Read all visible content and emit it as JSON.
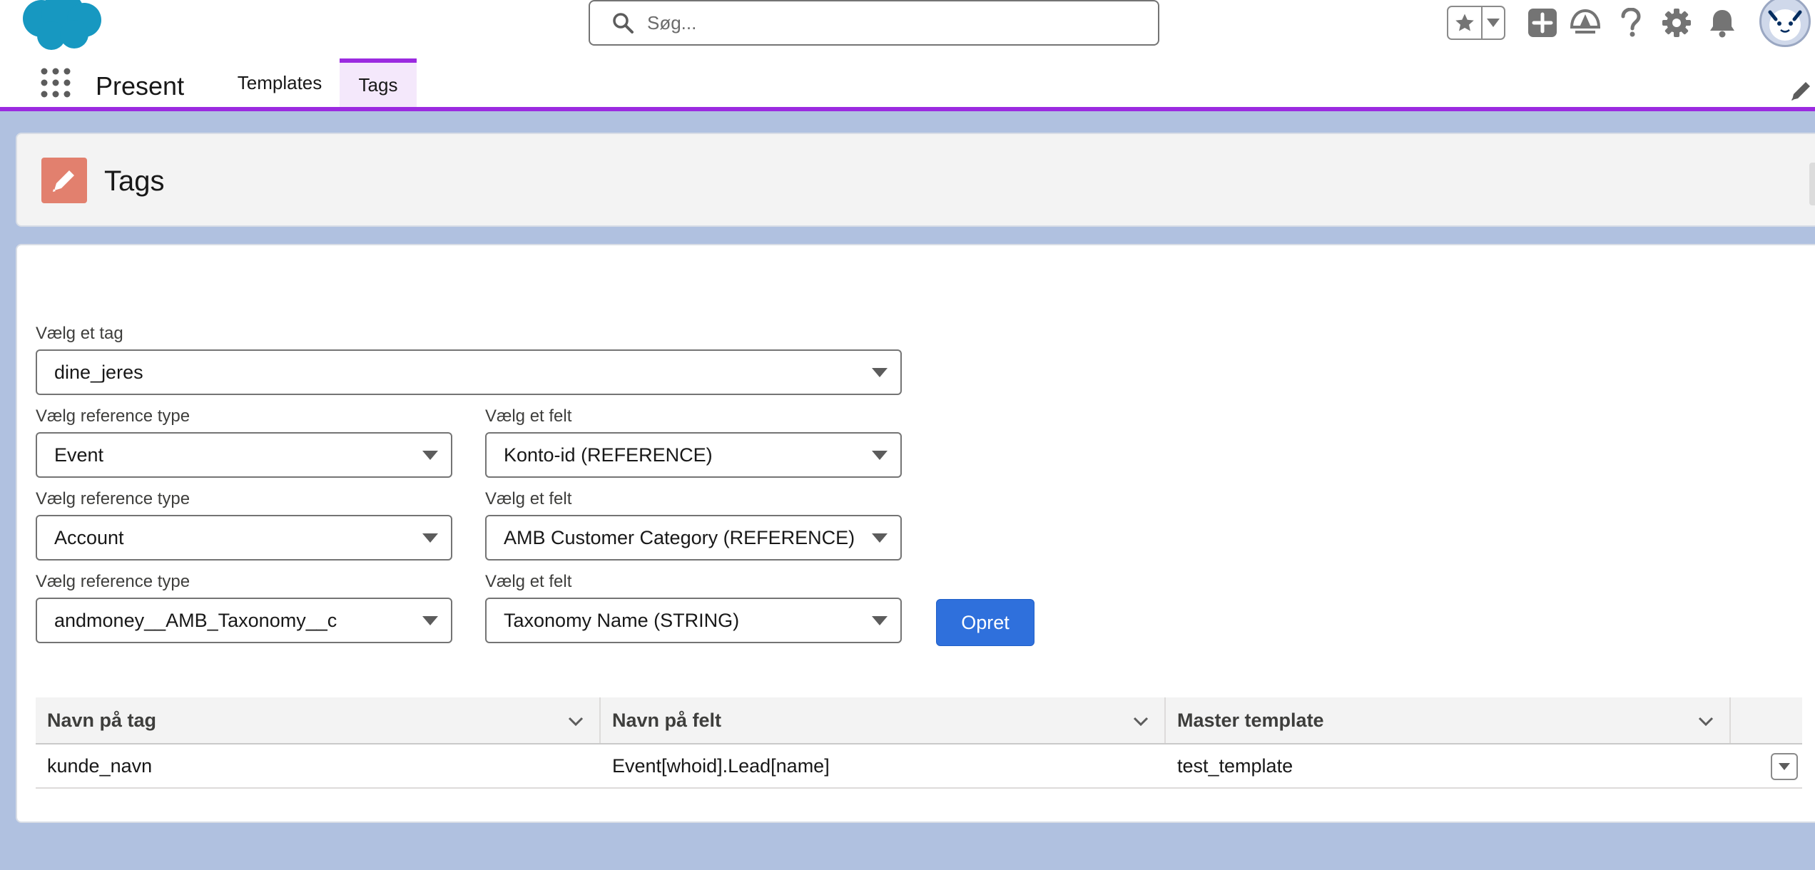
{
  "header": {
    "search": {
      "placeholder": "Søg..."
    }
  },
  "app": {
    "name": "Present",
    "tabs": [
      {
        "label": "Templates"
      },
      {
        "label": "Tags"
      }
    ],
    "active_tab": "Tags"
  },
  "page": {
    "title": "Tags"
  },
  "form": {
    "tag": {
      "label": "Vælg et tag",
      "value": "dine_jeres"
    },
    "rows": [
      {
        "ref_label": "Vælg reference type",
        "ref_value": "Event",
        "field_label": "Vælg et felt",
        "field_value": "Konto-id (REFERENCE)"
      },
      {
        "ref_label": "Vælg reference type",
        "ref_value": "Account",
        "field_label": "Vælg et felt",
        "field_value": "AMB Customer Category (REFERENCE)"
      },
      {
        "ref_label": "Vælg reference type",
        "ref_value": "andmoney__AMB_Taxonomy__c",
        "field_label": "Vælg et felt",
        "field_value": "Taxonomy Name (STRING)"
      }
    ],
    "create_label": "Opret"
  },
  "table": {
    "columns": [
      "Navn på tag",
      "Navn på felt",
      "Master template"
    ],
    "rows": [
      [
        "kunde_navn",
        "Event[whoid].Lead[name]",
        "test_template"
      ]
    ]
  },
  "colors": {
    "brand_purple": "#9b2ae0",
    "primary_button": "#2f70dc",
    "page_icon": "#e2806e",
    "logo_blue": "#1798c1"
  }
}
